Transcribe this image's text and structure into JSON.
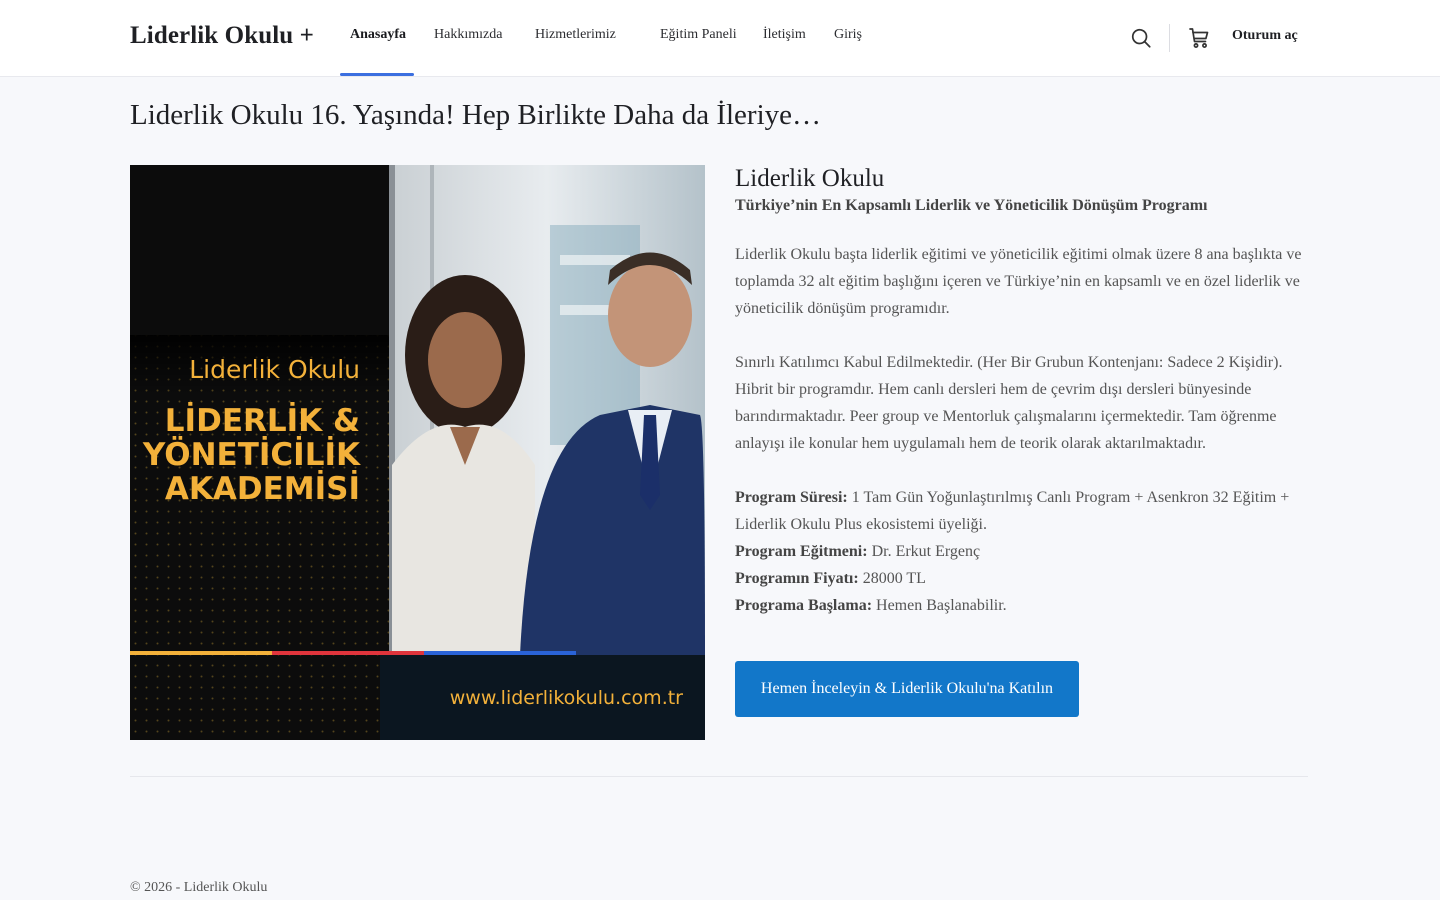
{
  "header": {
    "logo": "Liderlik Okulu +",
    "nav": [
      {
        "label": "Anasayfa"
      },
      {
        "label": "Hakkımızda"
      },
      {
        "label": "Hizmetlerimiz"
      },
      {
        "label": "Eğitim Paneli"
      },
      {
        "label": "İletişim"
      },
      {
        "label": "Giriş"
      }
    ],
    "search_icon": "search-icon",
    "cart_icon": "cart-icon",
    "login_label": "Oturum aç"
  },
  "page_title": "Liderlik Okulu 16. Yaşında! Hep Birlikte Daha da İleriye…",
  "hero": {
    "brand_small": "Liderlik Okulu",
    "line1": "LİDERLİK &",
    "line2": "YÖNETİCİLİK",
    "line3": "AKADEMİSİ",
    "url": "www.liderlikokulu.com.tr"
  },
  "program": {
    "title": "Liderlik Okulu",
    "subtitle": "Türkiye’nin En Kapsamlı Liderlik ve Yöneticilik Dönüşüm Programı",
    "p1": "Liderlik Okulu başta liderlik eğitimi ve yöneticilik eğitimi olmak üzere 8 ana başlıkta ve toplamda 32 alt eğitim başlığını içeren ve Türkiye’nin en kapsamlı ve en özel liderlik ve yöneticilik dönüşüm programıdır.",
    "p2": "Sınırlı Katılımcı Kabul Edilmektedir. (Her Bir Grubun Kontenjanı: Sadece 2 Kişidir). Hibrit bir programdır. Hem canlı dersleri hem de çevrim dışı dersleri bünyesinde barındırmaktadır. Peer group ve Mentorluk çalışmalarını içermektedir. Tam öğrenme anlayışı ile konular hem uygulamalı hem de teorik olarak aktarılmaktadır.",
    "details": [
      {
        "label": "Program Süresi:",
        "value": " 1 Tam Gün Yoğunlaştırılmış Canlı Program  + Asenkron 32 Eğitim + Liderlik Okulu Plus ekosistemi üyeliği."
      },
      {
        "label": "Program Eğitmeni:",
        "value": " Dr. Erkut Ergenç"
      },
      {
        "label": "Programın Fiyatı:",
        "value": " 28000 TL"
      },
      {
        "label": "Programa Başlama:",
        "value": " Hemen Başlanabilir."
      }
    ],
    "cta_label": "Hemen İnceleyin & Liderlik Okulu'na Katılın"
  },
  "footer": {
    "copyright": "© 2026 - Liderlik Okulu"
  },
  "colors": {
    "accent": "#1277c9",
    "nav_active": "#3b6fe0",
    "hero_gold": "#f3b13a"
  }
}
